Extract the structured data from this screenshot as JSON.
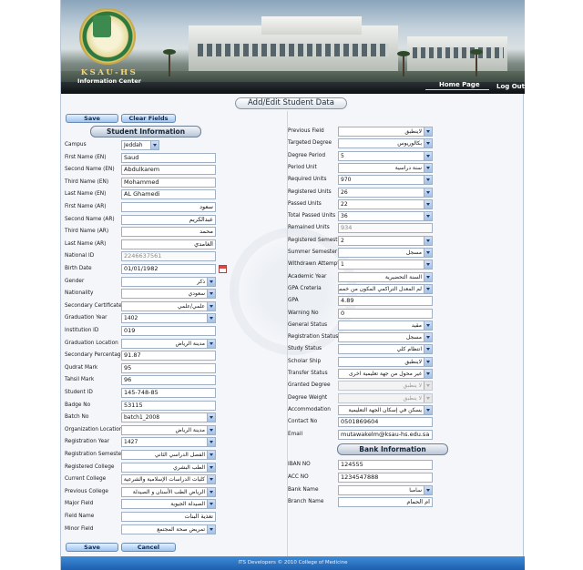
{
  "header": {
    "logo_text": "KSAU-HS",
    "logo_subtitle": "Information Center",
    "home_link": "Home Page",
    "logout_link": "Log Out"
  },
  "page_title": "Add/Edit Student Data",
  "buttons": {
    "save_top": "Save",
    "clear_fields": "Clear Fields",
    "save_bottom": "Save",
    "cancel": "Cancel"
  },
  "sections": {
    "student_info": "Student Information",
    "bank_info": "Bank Information"
  },
  "left_fields": [
    {
      "label": "Campus",
      "value": "Jeddah",
      "type": "select"
    },
    {
      "label": "First Name (EN)",
      "value": "Saud",
      "type": "text"
    },
    {
      "label": "Second Name (EN)",
      "value": "Abdulkarem",
      "type": "text"
    },
    {
      "label": "Third Name (EN)",
      "value": "Mohammed",
      "type": "text"
    },
    {
      "label": "Last Name (EN)",
      "value": "AL Ghamedi",
      "type": "text"
    },
    {
      "label": "First Name (AR)",
      "value": "سعود",
      "type": "text",
      "rtl": true
    },
    {
      "label": "Second Name (AR)",
      "value": "عبدالكريم",
      "type": "text",
      "rtl": true
    },
    {
      "label": "Third Name (AR)",
      "value": "محمد",
      "type": "text",
      "rtl": true
    },
    {
      "label": "Last Name (AR)",
      "value": "الغامدي",
      "type": "text",
      "rtl": true
    },
    {
      "label": "National ID",
      "value": "2246637561",
      "type": "text",
      "disabled": true
    },
    {
      "label": "Birth Date",
      "value": "01/01/1982",
      "type": "date"
    },
    {
      "label": "Gender",
      "value": "ذكر",
      "type": "select",
      "rtl": true
    },
    {
      "label": "Nationality",
      "value": "سعودي",
      "type": "select",
      "rtl": true
    },
    {
      "label": "Secondary Certificate",
      "value": "علمي/علمي",
      "type": "select",
      "rtl": true
    },
    {
      "label": "Graduation Year",
      "value": "1402",
      "type": "select"
    },
    {
      "label": "Institution ID",
      "value": "019",
      "type": "text"
    },
    {
      "label": "Graduation Location",
      "value": "مدينة الرياض",
      "type": "select",
      "rtl": true
    },
    {
      "label": "Secondary Percentage",
      "value": "91.87",
      "type": "text"
    },
    {
      "label": "Qudrat Mark",
      "value": "95",
      "type": "text"
    },
    {
      "label": "Tahsil Mark",
      "value": "96",
      "type": "text"
    },
    {
      "label": "Student ID",
      "value": "145-748-85",
      "type": "text"
    },
    {
      "label": "Badge No",
      "value": "53115",
      "type": "text"
    },
    {
      "label": "Batch No",
      "value": "batch1_2008",
      "type": "select"
    },
    {
      "label": "Organization Location",
      "value": "مدينة الرياض",
      "type": "select",
      "rtl": true
    },
    {
      "label": "Registration Year",
      "value": "1427",
      "type": "select"
    },
    {
      "label": "Registration Semester",
      "value": "الفصل الدراسي الثاني",
      "type": "select",
      "rtl": true
    },
    {
      "label": "Registered College",
      "value": "الطب البشري",
      "type": "select",
      "rtl": true
    },
    {
      "label": "Current College",
      "value": "كليات الدراسات الإسلامية والشرعية",
      "type": "select",
      "rtl": true
    },
    {
      "label": "Previous College",
      "value": "الرياض الطب الأسنان و الصيدلة",
      "type": "select",
      "rtl": true
    },
    {
      "label": "Major Field",
      "value": "الصيدلة الجيوية",
      "type": "select",
      "rtl": true
    },
    {
      "label": "Field Name",
      "value": "تغذية البنات",
      "type": "text",
      "rtl": true
    },
    {
      "label": "Minor Field",
      "value": "تمريض صحة المجتمع",
      "type": "select",
      "rtl": true
    }
  ],
  "right_fields": [
    {
      "label": "Previous Field",
      "value": "لاينطبق",
      "type": "select",
      "rtl": true
    },
    {
      "label": "Targeted Degree",
      "value": "بكالوريوس",
      "type": "select",
      "rtl": true
    },
    {
      "label": "Degree Period",
      "value": "5",
      "type": "select"
    },
    {
      "label": "Period Unit",
      "value": "سنة دراسية",
      "type": "select",
      "rtl": true
    },
    {
      "label": "Required Units",
      "value": "970",
      "type": "select"
    },
    {
      "label": "Registered Units",
      "value": "26",
      "type": "select"
    },
    {
      "label": "Passed Units",
      "value": "22",
      "type": "select"
    },
    {
      "label": "Total Passed Units",
      "value": "36",
      "type": "select"
    },
    {
      "label": "Remained Units",
      "value": "934",
      "type": "text",
      "disabled": true
    },
    {
      "label": "Registered Semesters",
      "value": "2",
      "type": "select"
    },
    {
      "label": "Summer Semester",
      "value": "مسجل",
      "type": "select",
      "rtl": true
    },
    {
      "label": "Withdrawn Attempts",
      "value": "1",
      "type": "select"
    },
    {
      "label": "Academic Year",
      "value": "السنة التحضيرية",
      "type": "select",
      "rtl": true
    },
    {
      "label": "GPA Creteria",
      "value": "لم المعدل التراكمي المكون من خمس نقاط",
      "type": "select",
      "rtl": true
    },
    {
      "label": "GPA",
      "value": "4.89",
      "type": "text"
    },
    {
      "label": "Warning No",
      "value": "0",
      "type": "text"
    },
    {
      "label": "General Status",
      "value": "مقيد",
      "type": "select",
      "rtl": true
    },
    {
      "label": "Registration Status",
      "value": "مسجل",
      "type": "select",
      "rtl": true
    },
    {
      "label": "Study Status",
      "value": "انتظام كلي",
      "type": "select",
      "rtl": true
    },
    {
      "label": "Scholar Ship",
      "value": "لاينطبق",
      "type": "select",
      "rtl": true
    },
    {
      "label": "Transfer Status",
      "value": "غير محول من جهة تعليمية اخرى",
      "type": "select",
      "rtl": true
    },
    {
      "label": "Granted Degree",
      "value": "لا ينطبق",
      "type": "select",
      "rtl": true,
      "disabled": true
    },
    {
      "label": "Degree Weight",
      "value": "لا ينطبق",
      "type": "select",
      "rtl": true,
      "disabled": true
    },
    {
      "label": "Accommodation",
      "value": "يسكن في إسكان الجهة التعليمية",
      "type": "select",
      "rtl": true
    },
    {
      "label": "Contact No",
      "value": "0501869604",
      "type": "text"
    },
    {
      "label": "Email",
      "value": "mutawakelm@ksau-hs.edu.sa",
      "type": "text"
    }
  ],
  "bank_fields": [
    {
      "label": "IBAN NO",
      "value": "124555",
      "type": "text"
    },
    {
      "label": "ACC NO",
      "value": "1234547888",
      "type": "text"
    },
    {
      "label": "Bank Name",
      "value": "سامبا",
      "type": "select",
      "rtl": true
    },
    {
      "label": "Branch Name",
      "value": "ام الحمام",
      "type": "text",
      "rtl": true
    }
  ],
  "footer": "ITS Developers © 2010 College of Medicine"
}
